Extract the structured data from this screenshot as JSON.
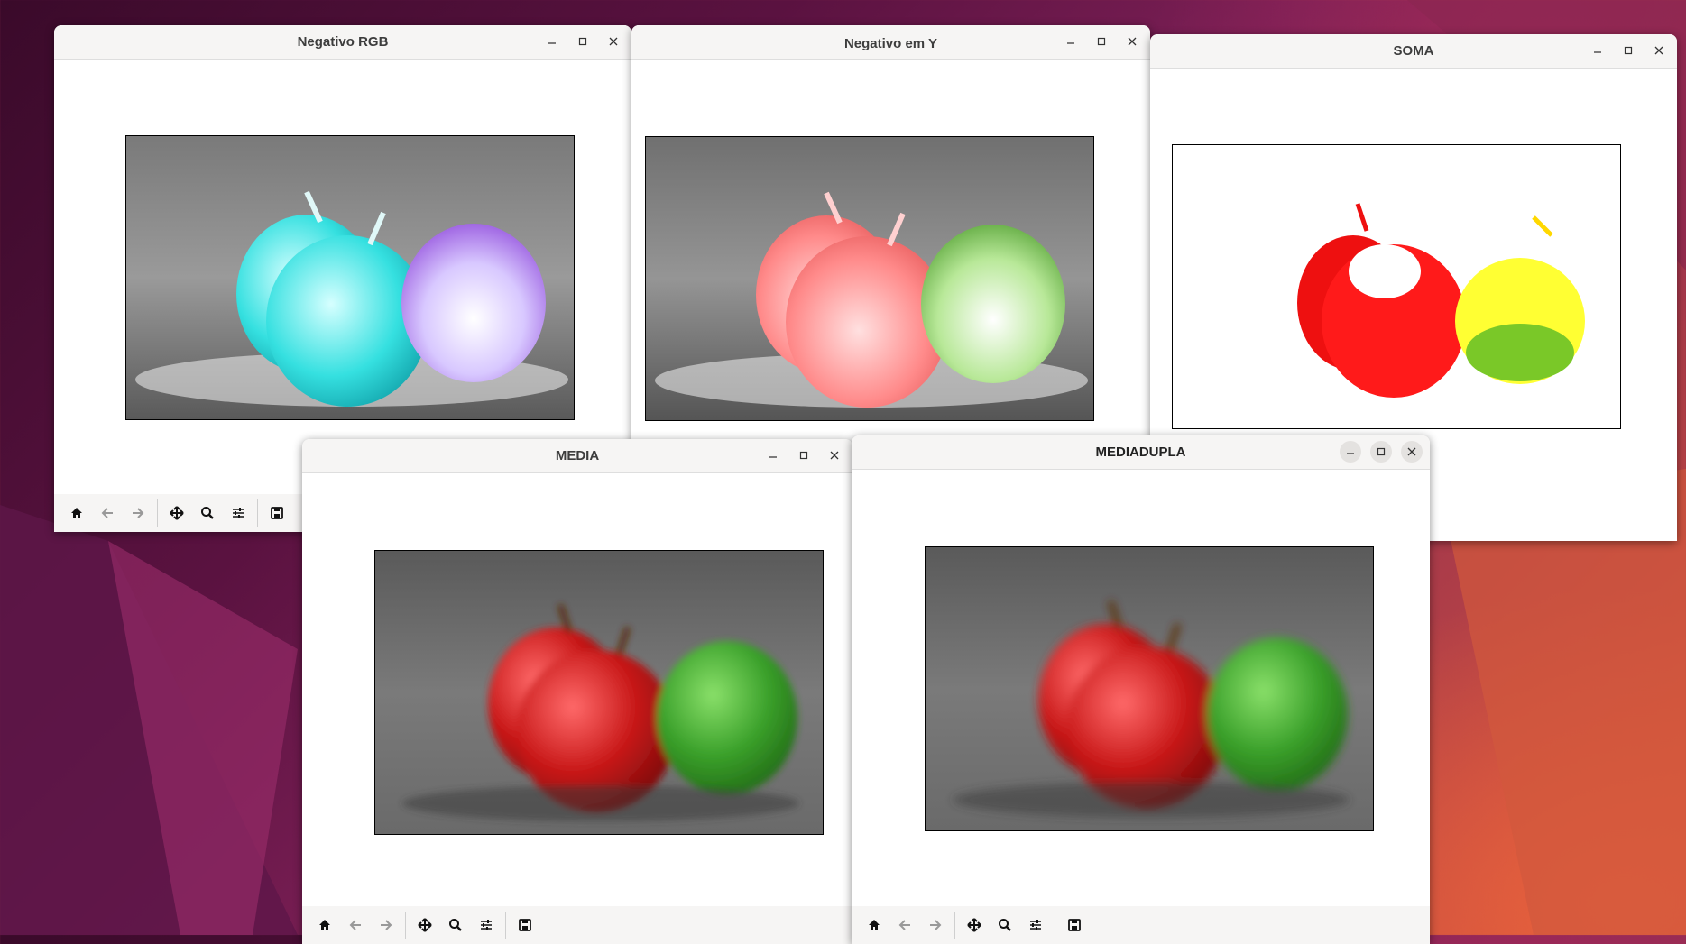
{
  "desktop": {
    "theme_colors": [
      "#3a0a2a",
      "#7b1f55",
      "#d8553a"
    ]
  },
  "windows": {
    "negativo_rgb": {
      "title": "Negativo RGB"
    },
    "negativo_y": {
      "title": "Negativo em Y"
    },
    "soma": {
      "title": "SOMA"
    },
    "media": {
      "title": "MEDIA"
    },
    "mediadupla": {
      "title": "MEDIADUPLA"
    }
  },
  "window_controls": [
    "minimize-icon",
    "maximize-icon",
    "close-icon"
  ],
  "toolbar_icons": [
    "home-icon",
    "back-arrow-icon",
    "forward-arrow-icon",
    "pan-move-icon",
    "zoom-icon",
    "configure-subplots-icon",
    "save-icon"
  ],
  "images": {
    "negativo_rgb": {
      "background": "#8a8a8a",
      "apple_colors": [
        "#35e0e0",
        "#bfa0ff"
      ]
    },
    "negativo_y": {
      "background": "#8a8a8a",
      "apple_colors": [
        "#ff8a8a",
        "#8fd16a"
      ]
    },
    "soma": {
      "background": "#ffffff",
      "apple_colors": [
        "#ff1a1a",
        "#ffff33"
      ]
    },
    "media": {
      "background": "#6a6a6a",
      "apple_colors": [
        "#c81818",
        "#3aa02a"
      ]
    },
    "mediadupla": {
      "background": "#6a6a6a",
      "apple_colors": [
        "#c81818",
        "#3aa02a"
      ]
    }
  }
}
